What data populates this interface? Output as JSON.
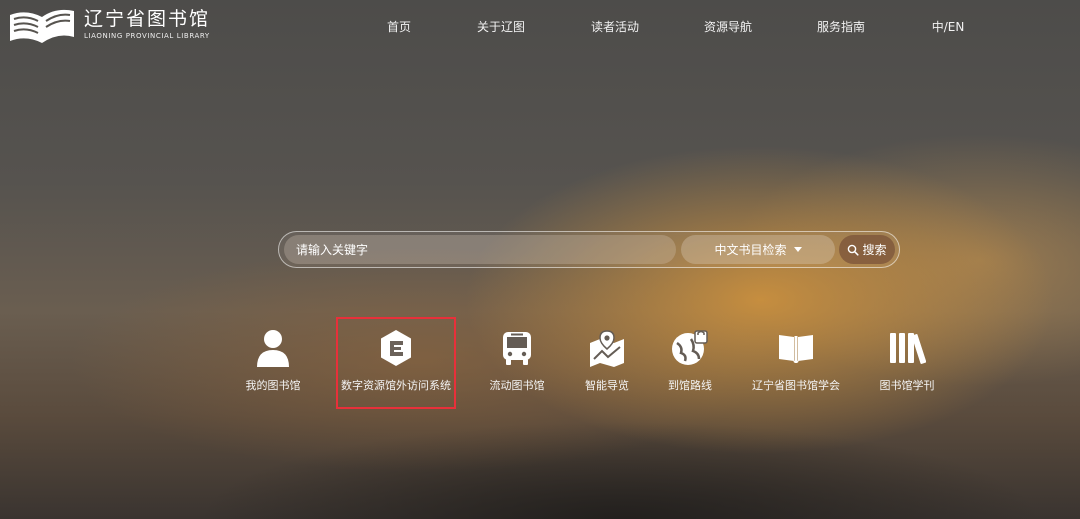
{
  "brand": {
    "name_cn": "辽宁省图书馆",
    "name_en": "LIAONING PROVINCIAL LIBRARY",
    "logo_icon": "open-book-icon"
  },
  "nav": {
    "items": [
      {
        "label": "首页"
      },
      {
        "label": "关于辽图"
      },
      {
        "label": "读者活动"
      },
      {
        "label": "资源导航"
      },
      {
        "label": "服务指南"
      },
      {
        "label": "中/EN"
      }
    ]
  },
  "search": {
    "placeholder": "请输入关键字",
    "selected_type": "中文书目检索",
    "button_label": "搜索"
  },
  "quick_links": [
    {
      "label": "我的图书馆",
      "icon": "user-icon"
    },
    {
      "label": "数字资源馆外访问系统",
      "icon": "e-hexagon-icon",
      "highlighted": true
    },
    {
      "label": "流动图书馆",
      "icon": "bus-icon"
    },
    {
      "label": "智能导览",
      "icon": "map-pin-icon"
    },
    {
      "label": "到馆路线",
      "icon": "route-icon"
    },
    {
      "label": "辽宁省图书馆学会",
      "icon": "open-book-icon"
    },
    {
      "label": "图书馆学刊",
      "icon": "books-icon"
    }
  ],
  "colors": {
    "highlight_border": "#e8303a",
    "search_button": "#7a5037"
  }
}
